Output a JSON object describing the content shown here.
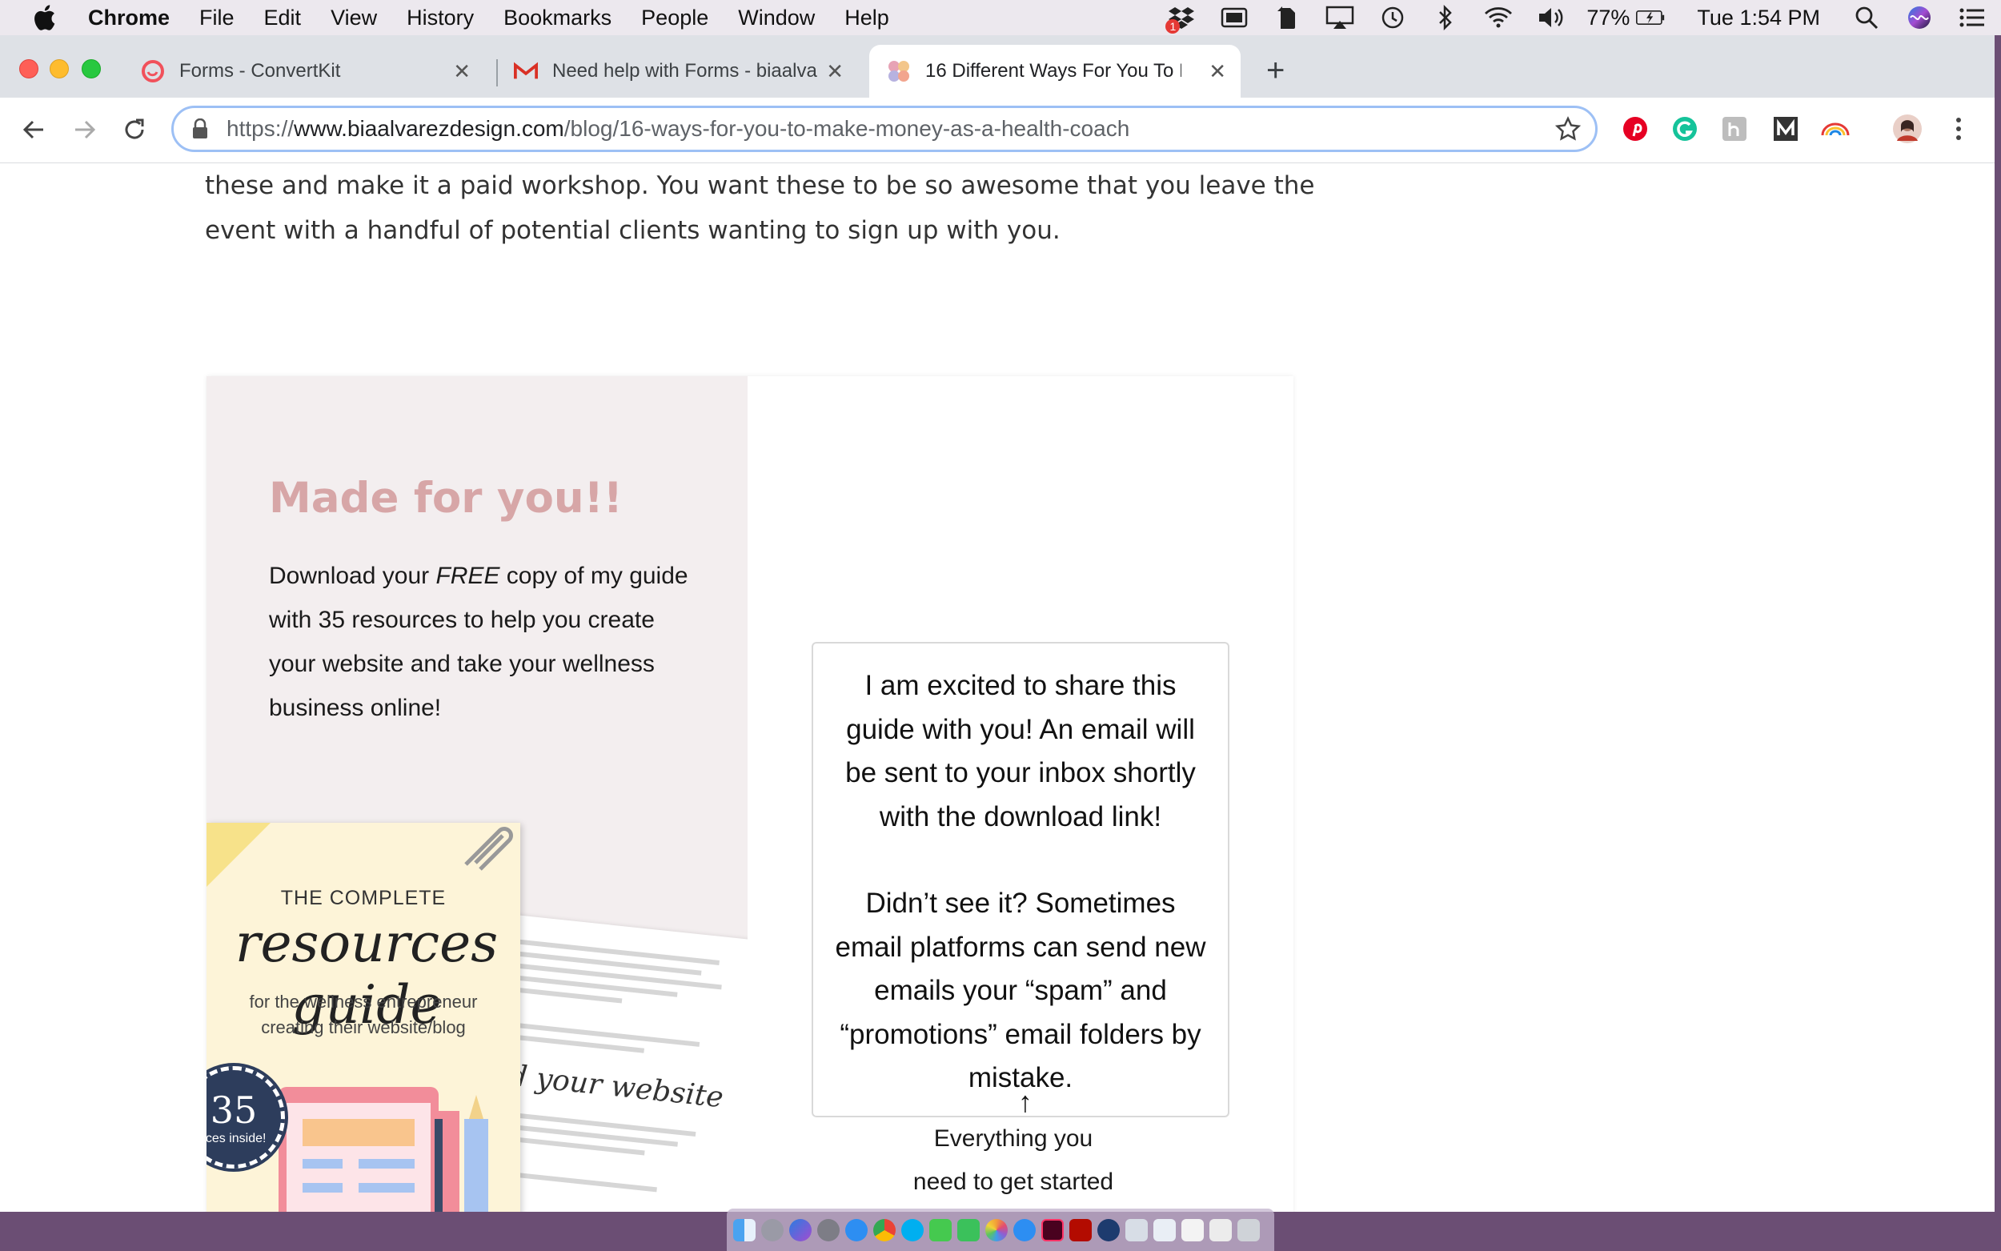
{
  "menubar": {
    "app": "Chrome",
    "items": [
      "File",
      "Edit",
      "View",
      "History",
      "Bookmarks",
      "People",
      "Window",
      "Help"
    ],
    "status": {
      "battery": "77%",
      "clock": "Tue 1:54 PM",
      "dropbox_badge": "1"
    }
  },
  "tabs": [
    {
      "title": "Forms - ConvertKit",
      "favicon": "convertkit-icon",
      "color": "#f1515b"
    },
    {
      "title": "Need help with Forms - biaalva",
      "favicon": "gmail-icon",
      "color": "#d93025"
    },
    {
      "title": "16 Different Ways For You To M",
      "favicon": "site-favicon",
      "color": "#e7a3b5"
    }
  ],
  "omnibox": {
    "scheme": "https://",
    "host": "www.biaalvarezdesign.com",
    "path": "/blog/16-ways-for-you-to-make-money-as-a-health-coach"
  },
  "article": {
    "paragraph_tail": "these and make it a paid workshop. You want these to be so awesome that you leave the event with a handful of potential clients wanting to sign up with you."
  },
  "optin": {
    "title": "Made for you!!",
    "desc_before": "Download your ",
    "desc_em": "FREE",
    "desc_after": " copy of my guide with 35 resources to help you create your website and take your wellness business online!",
    "cover": {
      "line1": "THE COMPLETE",
      "script": "resources guide",
      "sub1": "for the wellness entrepreneur",
      "sub2": "creating their website/blog",
      "seal_number": "35",
      "seal_text": "rces inside!"
    },
    "sheet_heading": "build your website",
    "confirmation": {
      "p1": "I am excited to share this guide with you! An email will be sent to your inbox shortly with the download link!",
      "p2": "Didn’t see it? Sometimes email platforms can send new emails your “spam” and “promotions” email folders by mistake."
    },
    "arrow": "↑",
    "cta_line1": "Everything you",
    "cta_line2": "need to get started"
  },
  "colors": {
    "accent_pink": "#d7a6a7",
    "panel_bg": "#f3eeef",
    "omnibox_focus": "#9dc0f5"
  }
}
